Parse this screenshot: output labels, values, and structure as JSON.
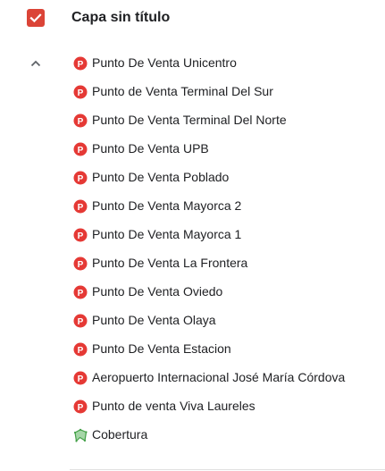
{
  "layer": {
    "title": "Capa sin título",
    "checked": true,
    "expanded": true,
    "accent_color": "#db4437"
  },
  "items": [
    {
      "label": "Punto De Venta Unicentro",
      "icon": "parking-marker-icon"
    },
    {
      "label": "Punto de Venta Terminal Del Sur",
      "icon": "parking-marker-icon"
    },
    {
      "label": "Punto De Venta Terminal Del Norte",
      "icon": "parking-marker-icon"
    },
    {
      "label": "Punto De Venta UPB",
      "icon": "parking-marker-icon"
    },
    {
      "label": "Punto De Venta Poblado",
      "icon": "parking-marker-icon"
    },
    {
      "label": "Punto De Venta Mayorca 2",
      "icon": "parking-marker-icon"
    },
    {
      "label": "Punto De Venta Mayorca 1",
      "icon": "parking-marker-icon"
    },
    {
      "label": "Punto De Venta La Frontera",
      "icon": "parking-marker-icon"
    },
    {
      "label": "Punto De Venta Oviedo",
      "icon": "parking-marker-icon"
    },
    {
      "label": "Punto De Venta Olaya",
      "icon": "parking-marker-icon"
    },
    {
      "label": "Punto De Venta Estacion",
      "icon": "parking-marker-icon"
    },
    {
      "label": "Aeropuerto Internacional José María Córdova",
      "icon": "parking-marker-icon"
    },
    {
      "label": "Punto de venta Viva Laureles",
      "icon": "parking-marker-icon"
    },
    {
      "label": "Cobertura",
      "icon": "polygon-icon"
    }
  ],
  "colors": {
    "marker_red": "#e53935",
    "polygon_green": "#43a047",
    "polygon_fill": "#a5d6a7"
  }
}
